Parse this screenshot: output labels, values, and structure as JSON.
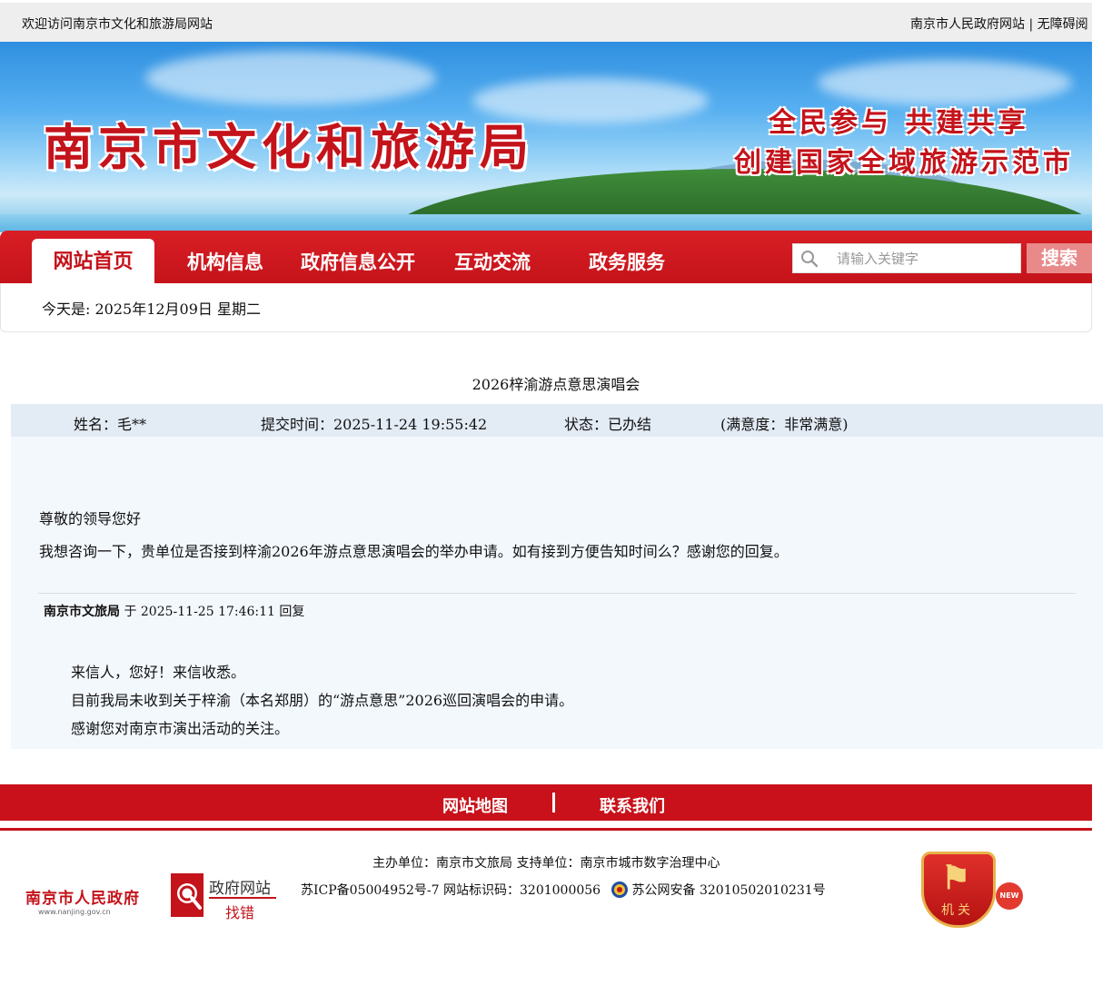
{
  "topbar": {
    "welcome": "欢迎访问南京市文化和旅游局网站",
    "gov_link": "南京市人民政府网站",
    "separator": " | ",
    "accessibility": "无障碍阅"
  },
  "banner": {
    "site_title": "南京市文化和旅游局",
    "slogan_line1": "全民参与 共建共享",
    "slogan_line2": "创建国家全域旅游示范市"
  },
  "nav": {
    "items": [
      "网站首页",
      "机构信息",
      "政府信息公开",
      "互动交流",
      "政务服务"
    ],
    "search_placeholder": "请输入关键字",
    "search_button": "搜索"
  },
  "date_bar": {
    "text": "今天是: 2025年12月09日 星期二"
  },
  "article": {
    "title": "2026梓渝游点意思演唱会",
    "meta": {
      "name": "姓名：毛**",
      "submit_time": "提交时间：2025-11-24 19:55:42",
      "status": "状态：已办结",
      "satisfaction": "(满意度：非常满意)"
    },
    "greeting": "尊敬的领导您好",
    "body": "我想咨询一下，贵单位是否接到梓渝2026年游点意思演唱会的举办申请。如有接到方便告知时间么？感谢您的回复。",
    "reply": {
      "org": "南京市文旅局",
      "meta_text": " 于 2025-11-25 17:46:11 回复",
      "lines": [
        "来信人，您好！来信收悉。",
        "目前我局未收到关于梓渝（本名郑朋）的“游点意思”2026巡回演唱会的申请。",
        "感谢您对南京市演出活动的关注。"
      ]
    }
  },
  "footer": {
    "nav": [
      "网站地图",
      "联系我们"
    ],
    "host_line": "主办单位：南京市文旅局   支持单位：南京市城市数字治理中心",
    "icp": "苏ICP备05004952号-7   网站标识码：3201000056 ",
    "police_record": "苏公网安备 32010502010231号",
    "logo_gov_text": "南京市人民政府",
    "logo_gov_url": "www.nanjing.gov.cn",
    "logo_error_line1": "政府网站",
    "logo_error_line2": "找错",
    "logo_jg_label": "机关",
    "logo_new": "NEW"
  },
  "colors": {
    "brand_red": "#c4131b",
    "meta_bg": "#e3ebf5",
    "content_bg": "#f3f8fd"
  }
}
